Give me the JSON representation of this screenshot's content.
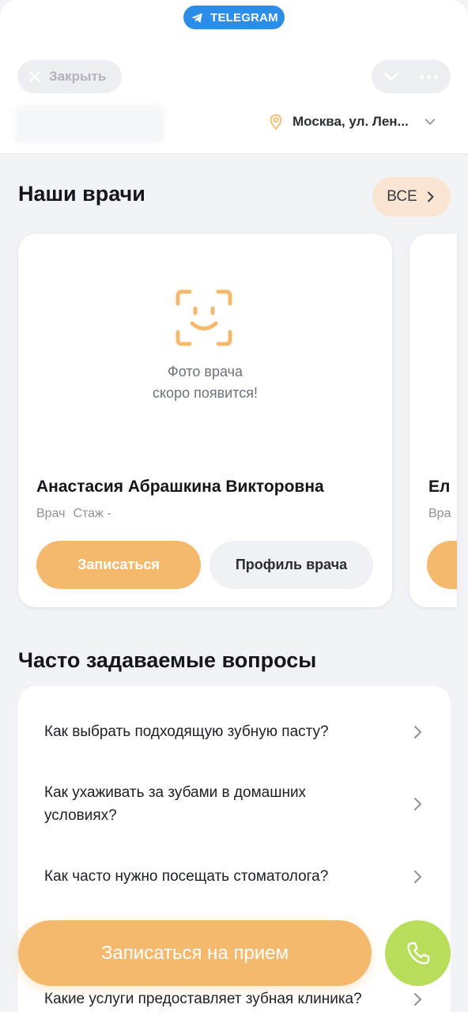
{
  "header": {
    "badge": "TELEGRAM",
    "close_label": "Закрыть",
    "location": "Москва, ул. Лен...",
    "colors": {
      "telegram": "#2b8de8",
      "accent": "#f5b96d"
    }
  },
  "doctors": {
    "title": "Наши врачи",
    "all_label": "ВСЕ",
    "card": {
      "photo_note_line1": "Фото врача",
      "photo_note_line2": "скоро появится!",
      "name": "Анастасия Абрашкина Викторовна",
      "role": "Врач",
      "experience": "Стаж -",
      "book_label": "Записаться",
      "profile_label": "Профиль врача"
    },
    "next_card": {
      "name_fragment": "Ел",
      "meta_fragment": "Вра"
    }
  },
  "faq": {
    "title": "Часто задаваемые вопросы",
    "items": [
      "Как выбрать подходящую зубную пасту?",
      "Как ухаживать за зубами в домашних условиях?",
      "Как часто нужно посещать стоматолога?",
      "Какие услуги предоставляет зубная клиника?"
    ]
  },
  "cta": {
    "label": "Записаться на прием",
    "call_icon": "phone-icon",
    "call_color": "#b8dd5a"
  }
}
